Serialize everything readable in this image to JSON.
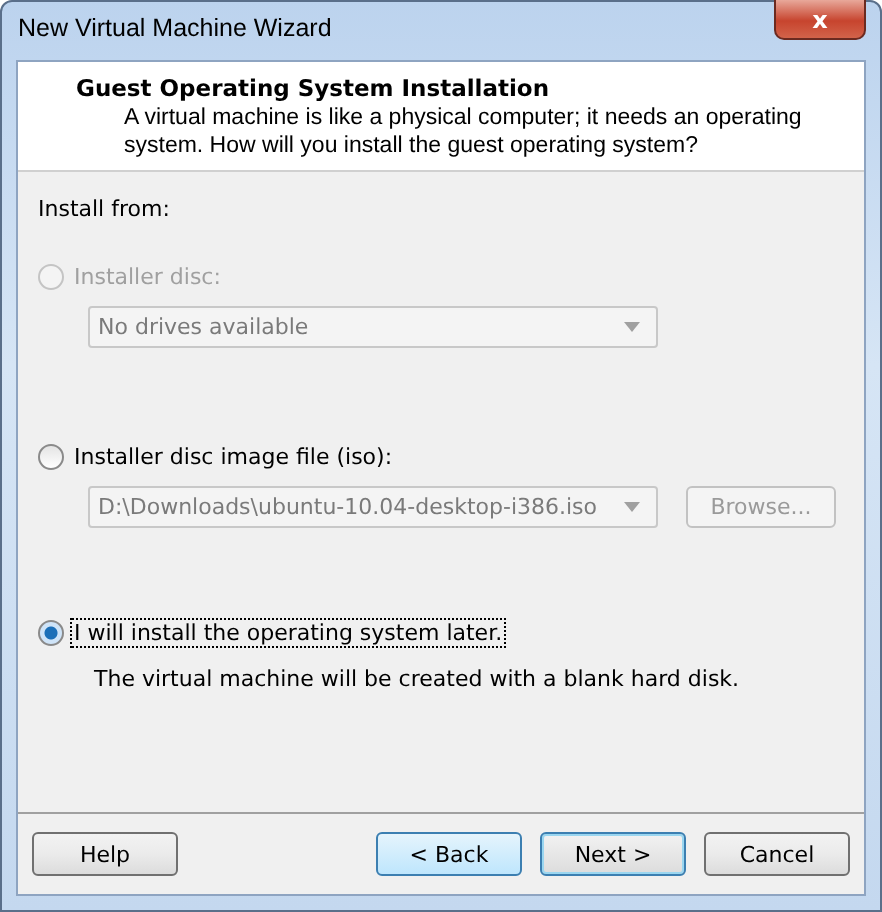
{
  "window": {
    "title": "New Virtual Machine Wizard",
    "close": "x"
  },
  "header": {
    "title": "Guest Operating System Installation",
    "description": "A virtual machine is like a physical computer; it needs an operating system. How will you install the guest operating system?"
  },
  "install_from": {
    "label": "Install from:",
    "options": [
      {
        "kind": "disc",
        "label": "Installer disc:",
        "selected": false,
        "disabled": true,
        "field": "No drives available"
      },
      {
        "kind": "iso",
        "label": "Installer disc image file (iso):",
        "selected": false,
        "disabled": false,
        "field": "D:\\Downloads\\ubuntu-10.04-desktop-i386.iso",
        "button": "Browse..."
      },
      {
        "kind": "later",
        "label": "I will install the operating system later.",
        "selected": true,
        "disabled": false,
        "note": "The virtual machine will be created with a blank hard disk."
      }
    ]
  },
  "buttons": [
    {
      "label": "Help",
      "kind": "help"
    },
    {
      "label": "< Back",
      "kind": "back"
    },
    {
      "label": "Next >",
      "kind": "next"
    },
    {
      "label": "Cancel",
      "kind": "cancel"
    }
  ]
}
